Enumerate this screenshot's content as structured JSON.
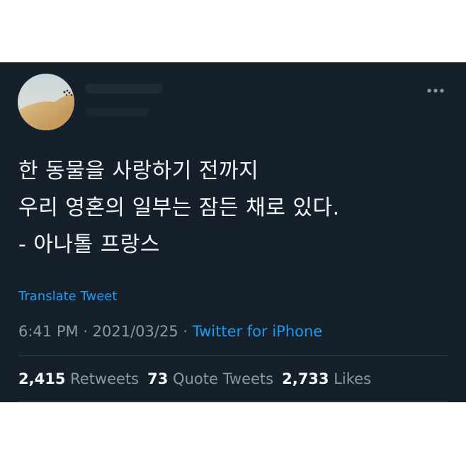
{
  "tweet": {
    "user_name": "",
    "user_handle": "",
    "lines": [
      "한 동물을 사랑하기 전까지",
      "우리 영혼의 일부는 잠든 채로 있다.",
      "- 아나톨 프랑스"
    ],
    "translate_label": "Translate Tweet",
    "time": "6:41 PM",
    "separator": " · ",
    "date": "2021/03/25",
    "source": "Twitter for iPhone",
    "more_icon": "more-dots-icon",
    "avatar_icon": "desert-dune-avatar"
  },
  "stats": {
    "retweets_count": "2,415",
    "retweets_label": "Retweets",
    "quotes_count": "73",
    "quotes_label": "Quote Tweets",
    "likes_count": "2,733",
    "likes_label": "Likes"
  },
  "colors": {
    "background": "#15202b",
    "text": "#f5f8fa",
    "muted": "#8899a6",
    "link": "#1d9bf0",
    "divider": "#38444d"
  }
}
